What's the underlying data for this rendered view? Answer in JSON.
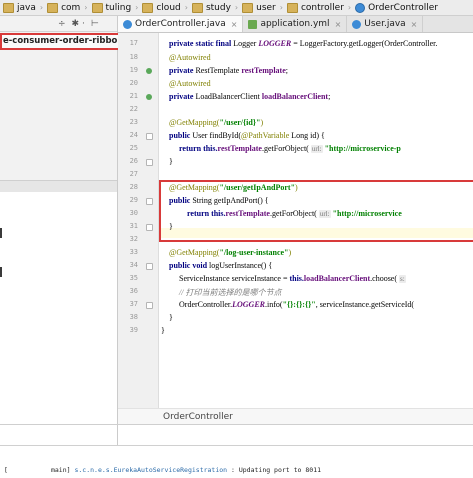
{
  "breadcrumb": [
    {
      "label": "java",
      "icon": "folder-icon"
    },
    {
      "label": "com",
      "icon": "folder-icon"
    },
    {
      "label": "tuling",
      "icon": "folder-icon"
    },
    {
      "label": "cloud",
      "icon": "folder-icon"
    },
    {
      "label": "study",
      "icon": "folder-icon"
    },
    {
      "label": "user",
      "icon": "folder-icon"
    },
    {
      "label": "controller",
      "icon": "folder-icon"
    },
    {
      "label": "OrderController",
      "icon": "class-icon"
    }
  ],
  "project": {
    "module_label": "e-consumer-order-ribbon]",
    "toolbar": [
      "÷",
      "✱ ·",
      "⊢"
    ]
  },
  "tabs": [
    {
      "label": "OrderController.java",
      "active": true
    },
    {
      "label": "application.yml",
      "active": false
    },
    {
      "label": "User.java",
      "active": false
    }
  ],
  "gutter": {
    "lines": [
      "17",
      "18",
      "19",
      "20",
      "21",
      "22",
      "23",
      "24",
      "25",
      "26",
      "27",
      "28",
      "29",
      "30",
      "31",
      "32",
      "33",
      "34",
      "35",
      "36",
      "37",
      "38",
      "39"
    ]
  },
  "code": {
    "l1_mods": "private static final",
    "l1_type": "Logger",
    "l1_name": "LOGGER",
    "l1_rest": "= LoggerFactory.getLogger(OrderController.",
    "l2": "@Autowired",
    "l3_kw": "private",
    "l3_type": "RestTemplate",
    "l3_name": "restTemplate",
    "l4": "@Autowired",
    "l5_kw": "private",
    "l5_type": "LoadBalancerClient",
    "l5_name": "loadBalancerClient",
    "l6_ann": "@GetMapping(",
    "l6_str": "\"/user/{id}\"",
    "l6_end": ")",
    "l7_kw": "public",
    "l7_rest": "User findById(",
    "l7_ann": "@PathVariable",
    "l7_end": "Long id) {",
    "l8_kw": "return this.",
    "l8_fld": "restTemplate",
    "l8_mid": ".getForObject(",
    "l8_hint": "url:",
    "l8_str": "\"http://microservice-p",
    "l9": "}",
    "l10_ann": "@GetMapping(",
    "l10_str": "\"/user/getIpAndPort\"",
    "l10_end": ")",
    "l11_kw": "public",
    "l11_rest": "String getIpAndPort() {",
    "l12_kw": "return this.",
    "l12_fld": "restTemplate",
    "l12_mid": ".getForObject(",
    "l12_hint": "url:",
    "l12_str": "\"http://microservice",
    "l13": "}",
    "l14_ann": "@GetMapping(",
    "l14_str": "\"/log-user-instance\"",
    "l14_end": ")",
    "l15_kw": "public void",
    "l15_rest": "logUserInstance() {",
    "l16_a": "ServiceInstance serviceInstance =",
    "l16_kw": "this.",
    "l16_fld": "loadBalancerClient",
    "l16_b": ".choose(",
    "l16_hint": "s:",
    "l17": "// 打印当前选择的是哪个节点",
    "l18_a": "OrderController.",
    "l18_fld": "LOGGER",
    "l18_b": ".info(",
    "l18_str": "\"{}:{}:{}\"",
    "l18_c": ", serviceInstance.getServiceId(",
    "l19": "}",
    "l20": "}"
  },
  "status": {
    "file_crumb": "OrderController"
  },
  "console": {
    "bracket": "[",
    "thread": "main]",
    "logger": "s.c.n.e.s.EurekaAutoServiceRegistration",
    "message": ": Updating port to 8011"
  }
}
